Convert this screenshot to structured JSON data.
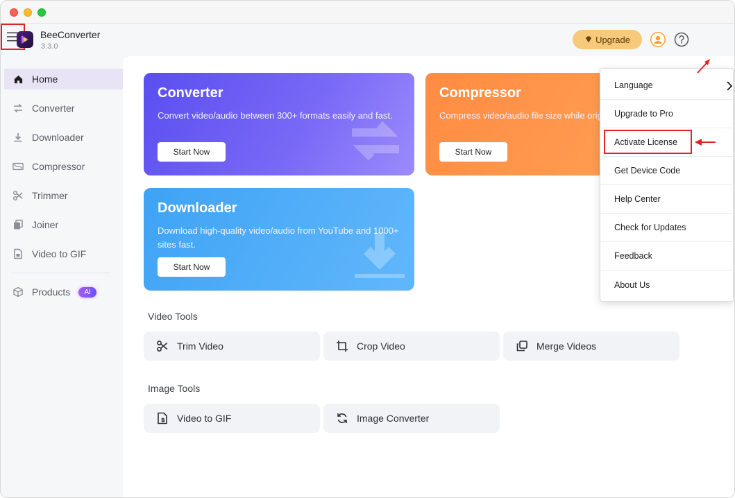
{
  "app": {
    "name": "BeeConverter",
    "version": "3.3.0"
  },
  "header": {
    "upgrade_label": "Upgrade"
  },
  "sidebar": {
    "items": [
      {
        "label": "Home",
        "icon": "home-icon",
        "active": true
      },
      {
        "label": "Converter",
        "icon": "convert-arrows-icon",
        "active": false
      },
      {
        "label": "Downloader",
        "icon": "download-icon",
        "active": false
      },
      {
        "label": "Compressor",
        "icon": "compress-icon",
        "active": false
      },
      {
        "label": "Trimmer",
        "icon": "scissors-icon",
        "active": false
      },
      {
        "label": "Joiner",
        "icon": "joiner-icon",
        "active": false
      },
      {
        "label": "Video to GIF",
        "icon": "gif-icon",
        "active": false
      }
    ],
    "products_label": "Products",
    "ai_badge": "AI"
  },
  "cards": [
    {
      "title": "Converter",
      "desc": "Convert video/audio between 300+ formats easily and fast.",
      "button": "Start Now"
    },
    {
      "title": "Compressor",
      "desc": "Compress video/audio file size while original quality.",
      "button": "Start Now"
    },
    {
      "title": "Downloader",
      "desc": "Download high-quality video/audio from YouTube and 1000+ sites fast.",
      "button": "Start Now"
    }
  ],
  "video_tools": {
    "title": "Video Tools",
    "items": [
      {
        "label": "Trim Video",
        "icon": "scissors-icon"
      },
      {
        "label": "Crop Video",
        "icon": "crop-icon"
      },
      {
        "label": "Merge Videos",
        "icon": "merge-icon"
      }
    ]
  },
  "image_tools": {
    "title": "Image Tools",
    "items": [
      {
        "label": "Video to GIF",
        "icon": "gif-file-icon"
      },
      {
        "label": "Image Converter",
        "icon": "refresh-icon"
      }
    ]
  },
  "menu": {
    "items": [
      "Language",
      "Upgrade to Pro",
      "Activate License",
      "Get Device Code",
      "Help Center",
      "Check for Updates",
      "Feedback",
      "About Us"
    ]
  },
  "colors": {
    "accent_purple": "#5a4ef0",
    "accent_orange": "#ff8c42",
    "accent_blue": "#3ea3f5",
    "annotation_red": "#e02424",
    "upgrade_gold": "#f7c97a"
  }
}
